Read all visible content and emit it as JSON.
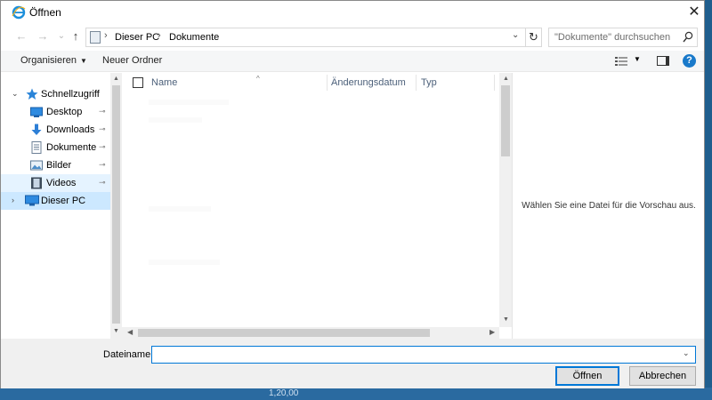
{
  "window": {
    "title": "Öffnen",
    "close_glyph": "✕"
  },
  "address": {
    "crumbs": [
      "Dieser PC",
      "Dokumente"
    ],
    "separator": "›",
    "search_placeholder": "\"Dokumente\" durchsuchen"
  },
  "nav_glyphs": {
    "back": "←",
    "forward": "→",
    "recent": "⌄",
    "up": "↑",
    "refresh": "↻",
    "dropdown": "⌄"
  },
  "toolbar": {
    "organize": "Organisieren",
    "organize_caret": "▼",
    "new_folder": "Neuer Ordner",
    "view_caret": "▼",
    "help": "?"
  },
  "navpane": {
    "items": [
      {
        "label": "Schnellzugriff",
        "icon": "star-icon",
        "chevron": "⌄",
        "pinned": false
      },
      {
        "label": "Desktop",
        "icon": "desktop-icon",
        "pinned": true
      },
      {
        "label": "Downloads",
        "icon": "download-icon",
        "pinned": true
      },
      {
        "label": "Dokumente",
        "icon": "document-icon",
        "pinned": true
      },
      {
        "label": "Bilder",
        "icon": "pictures-icon",
        "pinned": true
      },
      {
        "label": "Videos",
        "icon": "videos-icon",
        "pinned": true
      },
      {
        "label": "Dieser PC",
        "icon": "computer-icon",
        "chevron": "›",
        "pinned": false
      }
    ],
    "pin_glyph": "⊸"
  },
  "filelist": {
    "columns": [
      "Name",
      "Änderungsdatum",
      "Typ"
    ],
    "sort_caret": "^",
    "scroll": {
      "up": "▲",
      "down": "▼",
      "left": "◀",
      "right": "▶"
    }
  },
  "preview": {
    "message": "Wählen Sie eine Datei für die Vorschau aus."
  },
  "bottom": {
    "filename_label": "Dateiname:",
    "filename_value": "",
    "open_label": "Öffnen",
    "cancel_label": "Abbrechen"
  },
  "background": {
    "status_text": "1,20,00"
  },
  "colors": {
    "accent": "#0078d7",
    "selection": "#cce8ff",
    "hover": "#e5f3ff",
    "help": "#1979ca"
  }
}
